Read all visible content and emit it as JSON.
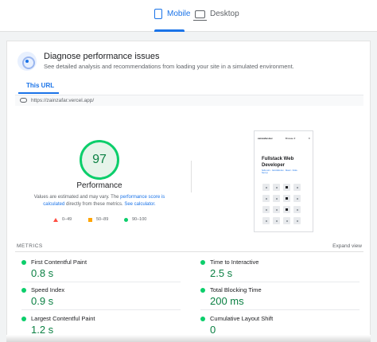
{
  "tabs": {
    "mobile": "Mobile",
    "desktop": "Desktop"
  },
  "diagnose": {
    "title": "Diagnose performance issues",
    "subtitle": "See detailed analysis and recommendations from loading your site in a simulated environment."
  },
  "url_tab": "This URL",
  "url": "https://zainzafar.vercel.app/",
  "performance": {
    "score": "97",
    "label": "Performance",
    "note_prefix": "Values are estimated and may vary. The ",
    "note_link1": "performance score is calculated",
    "note_mid": " directly from these metrics. ",
    "note_link2": "See calculator."
  },
  "legend": {
    "low": "0–49",
    "mid": "50–89",
    "high": "90–100"
  },
  "preview": {
    "logo": "zainzafar.dev",
    "menu": "Browse ▾",
    "close": "✕",
    "title_line1": "Fullstack Web",
    "title_line2": "Developer",
    "sub": "hello.com - zainzafar.dev · React · Node · Next.js"
  },
  "metrics_title": "METRICS",
  "expand_view": "Expand view",
  "metrics": [
    {
      "label": "First Contentful Paint",
      "value": "0.8 s"
    },
    {
      "label": "Time to Interactive",
      "value": "2.5 s"
    },
    {
      "label": "Speed Index",
      "value": "0.9 s"
    },
    {
      "label": "Total Blocking Time",
      "value": "200 ms"
    },
    {
      "label": "Largest Contentful Paint",
      "value": "1.2 s"
    },
    {
      "label": "Cumulative Layout Shift",
      "value": "0"
    }
  ],
  "colors": {
    "accent": "#1a73e8",
    "good": "#0cce6b",
    "good_text": "#0b8043",
    "average": "#ffa400",
    "poor": "#ff4e42"
  }
}
